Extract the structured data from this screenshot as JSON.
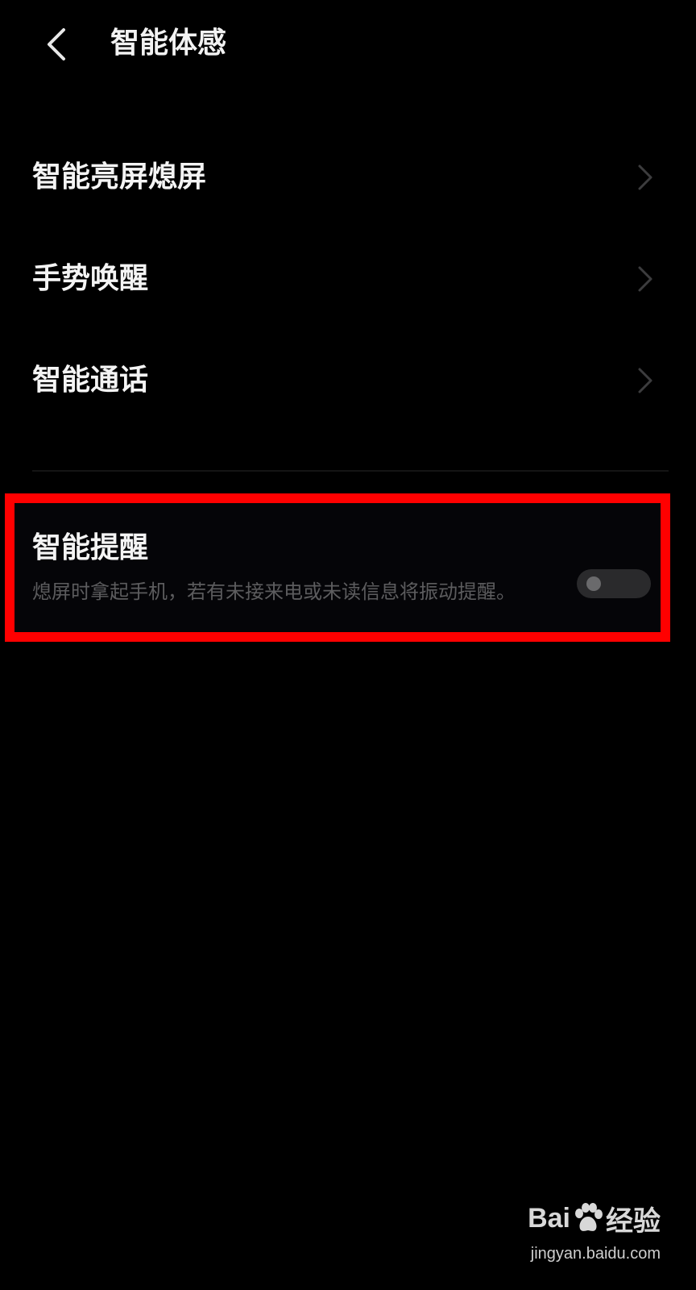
{
  "header": {
    "title": "智能体感"
  },
  "menu": {
    "items": [
      {
        "label": "智能亮屏熄屏"
      },
      {
        "label": "手势唤醒"
      },
      {
        "label": "智能通话"
      }
    ]
  },
  "smart_reminder": {
    "title": "智能提醒",
    "description": "熄屏时拿起手机，若有未接来电或未读信息将振动提醒。",
    "enabled": false
  },
  "watermark": {
    "logo_left": "Bai",
    "logo_right": "经验",
    "url": "jingyan.baidu.com"
  },
  "colors": {
    "background": "#000000",
    "highlight": "#ff0000",
    "text_primary": "#f4f4f4",
    "text_secondary": "#5c5c5e"
  }
}
